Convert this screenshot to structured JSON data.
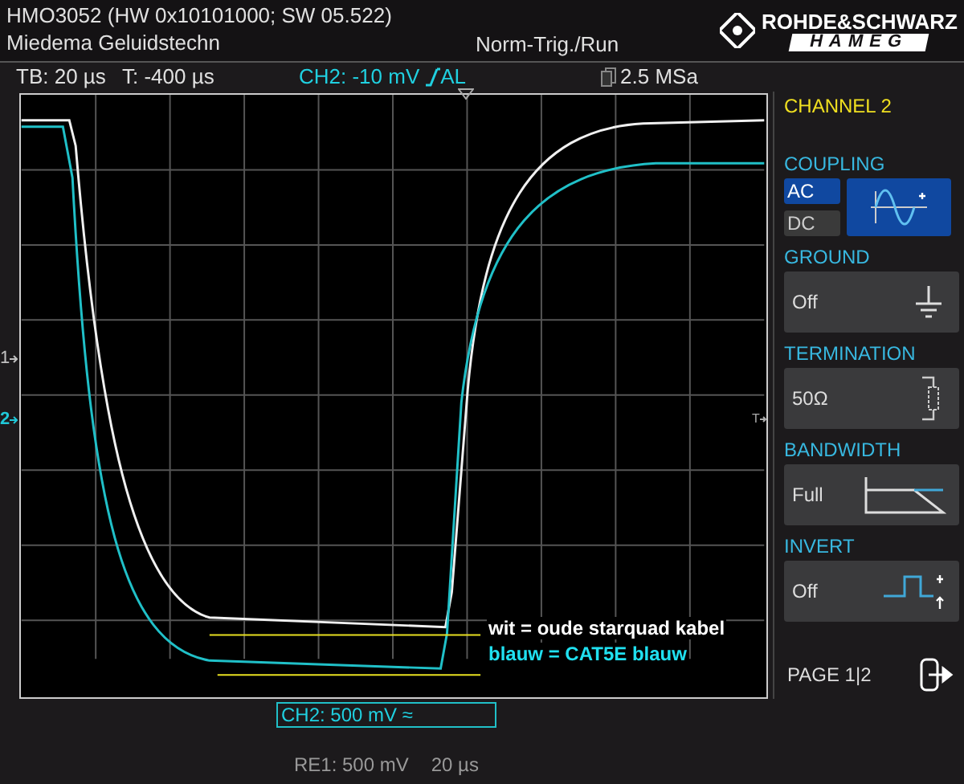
{
  "header": {
    "model": "HMO3052 (HW 0x10101000; SW 05.522)",
    "owner": "Miedema Geluidstechn",
    "trigger_mode": "Norm-Trig./Run",
    "brand_top": "ROHDE&SCHWARZ",
    "brand_bottom": "HAMEG"
  },
  "status_bar": {
    "timebase": "TB: 20 µs",
    "trigger_time": "T: -400 µs",
    "trigger_level": "CH2: -10 mV",
    "trigger_source": "AL",
    "sample_rate": "2.5 MSa"
  },
  "plot": {
    "channel_markers": [
      {
        "label": "1",
        "color": "#c0c0c0"
      },
      {
        "label": "2",
        "color": "#20c8d8"
      }
    ],
    "trigger_marker": "T",
    "annotations": [
      {
        "text": "wit = oude starquad kabel",
        "color": "#ffffff"
      },
      {
        "text": "blauw = CAT5E blauw",
        "color": "#20e0f0"
      }
    ],
    "channel_label": "CH2: 500 mV",
    "channel_label_symbol": "≈",
    "reference": "RE1: 500 mV",
    "reference_timebase": "20 µs"
  },
  "menu": {
    "title": "CHANNEL 2",
    "sections": [
      {
        "heading": "COUPLING",
        "kind": "coupling",
        "options": [
          {
            "label": "AC",
            "selected": true
          },
          {
            "label": "DC",
            "selected": false
          }
        ]
      },
      {
        "heading": "GROUND",
        "kind": "ground",
        "value": "Off"
      },
      {
        "heading": "TERMINATION",
        "kind": "termination",
        "value": "50Ω"
      },
      {
        "heading": "BANDWIDTH",
        "kind": "bandwidth",
        "value": "Full"
      },
      {
        "heading": "INVERT",
        "kind": "invert",
        "value": "Off"
      }
    ],
    "page": "PAGE 1|2"
  }
}
